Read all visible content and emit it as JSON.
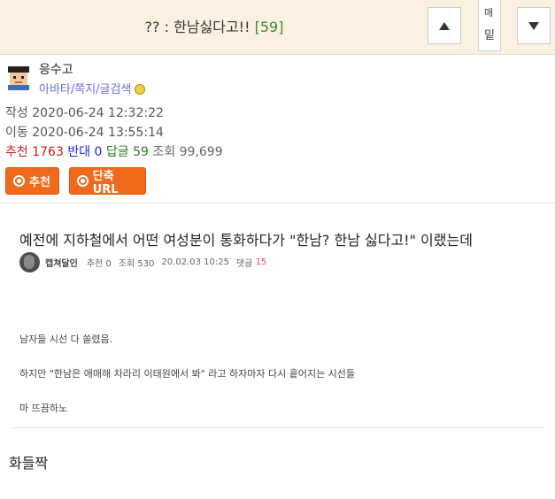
{
  "header": {
    "title": "?? : 한남싫다고!!",
    "comment_count": "[59]",
    "mini_tab_top": "매",
    "mini_tab_bottom": "밑",
    "up_icon": "triangle-up",
    "down_icon": "triangle-down"
  },
  "author": {
    "name": "응수고",
    "links": "아바타/쪽지/글검색"
  },
  "meta": {
    "created_label": "작성",
    "created": "2020-06-24 12:32:22",
    "moved_label": "이동",
    "moved": "2020-06-24 13:55:14",
    "recommend_label": "추천",
    "recommend": "1763",
    "oppose_label": "반대",
    "oppose": "0",
    "reply_label": "답글",
    "reply": "59",
    "views_label": "조회",
    "views": "99,699"
  },
  "buttons": {
    "recommend": "추천",
    "short_url": "단축URL"
  },
  "post": {
    "title": "예전에 지하철에서 어떤 여성분이 통화하다가 \"한남? 한남 싫다고!\" 이랬는데",
    "nick": "캡쳐달인",
    "recommend": "추천 0",
    "views": "조회 530",
    "date": "20.02.03 10:25",
    "comment_label": "댓글",
    "comment_count": "15",
    "paragraphs": [
      "남자들 시선 다 쏠렸음.",
      "하지만 \"한남은 애매해 차라리 이태원에서 봐\" 라고 하자마자 다시 흩어지는 시선들",
      "마 뜨끔하노"
    ]
  },
  "footer_text": "화들짝",
  "colors": {
    "header_bg": "#fbf1e3",
    "accent_orange": "#f06a1c",
    "recommend_red": "#cc1f1f",
    "oppose_blue": "#1d2bd8",
    "reply_green": "#2e7d23",
    "link_purple": "#6d6fd6"
  }
}
